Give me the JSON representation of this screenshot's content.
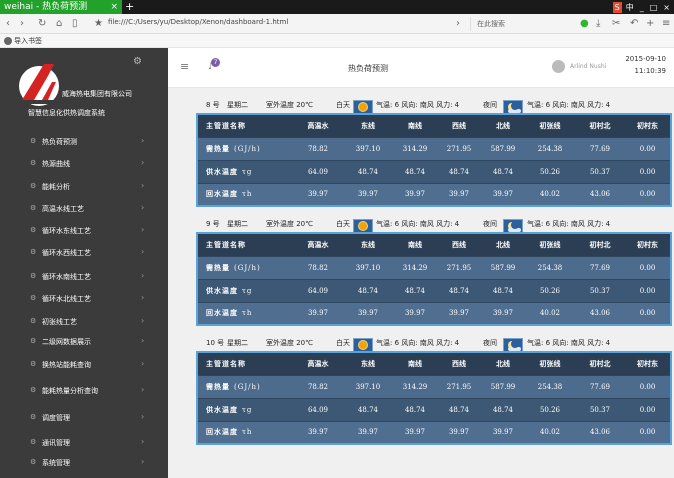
{
  "browser": {
    "tab_title": "weihai - 热负荷预测",
    "tab_close": "×",
    "new_tab": "+",
    "url": "file:///C:/Users/yu/Desktop/Xenon/dashboard-1.html",
    "search_placeholder": "在此搜索",
    "ime_indicator": "中",
    "bookmarks_label": "导入书签"
  },
  "sidebar": {
    "company": "威海热电集团有限公司",
    "system_name": "智慧信息化供热调度系统",
    "items": [
      {
        "label": "热负荷预测"
      },
      {
        "label": "热源曲线"
      },
      {
        "label": "能耗分析"
      },
      {
        "label": "高温水线工艺"
      },
      {
        "label": "循环水东线工艺"
      },
      {
        "label": "循环水西线工艺"
      },
      {
        "label": "循环水南线工艺"
      },
      {
        "label": "循环水北线工艺"
      },
      {
        "label": "初张线工艺"
      },
      {
        "label": "二级网数据展示"
      },
      {
        "label": "换热站能耗查询"
      },
      {
        "label": "能耗热量分析查询"
      },
      {
        "label": "调度管理"
      },
      {
        "label": "通讯管理"
      },
      {
        "label": "系统管理"
      }
    ]
  },
  "header": {
    "title": "热负荷预测",
    "notification_count": "7",
    "user_name": "Arlind Nushi",
    "date": "2015-09-10",
    "time": "11:10:39"
  },
  "table_columns": [
    "主管道名称",
    "高温水",
    "东线",
    "南线",
    "西线",
    "北线",
    "初张线",
    "初村北",
    "初村东"
  ],
  "days": [
    {
      "day": "8 号",
      "weekday": "星期二",
      "outdoor_temp": "室外温度 20℃",
      "daytime_label": "白天",
      "day_weather": "气温: 6 风向: 南风 风力: 4",
      "night_label": "夜间",
      "night_weather": "气温: 6 风向: 南风 风力: 4",
      "rows": [
        {
          "name": "需热量",
          "unit": "(GJ/h)",
          "values": [
            "78.82",
            "397.10",
            "314.29",
            "271.95",
            "587.99",
            "254.38",
            "77.69",
            "0.00"
          ]
        },
        {
          "name": "供水温度",
          "unit": "τg",
          "values": [
            "64.09",
            "48.74",
            "48.74",
            "48.74",
            "48.74",
            "50.26",
            "50.37",
            "0.00"
          ]
        },
        {
          "name": "回水温度",
          "unit": "τh",
          "values": [
            "39.97",
            "39.97",
            "39.97",
            "39.97",
            "39.97",
            "40.02",
            "43.06",
            "0.00"
          ]
        }
      ]
    },
    {
      "day": "9 号",
      "weekday": "星期二",
      "outdoor_temp": "室外温度 20℃",
      "daytime_label": "白天",
      "day_weather": "气温: 6 风向: 南风 风力: 4",
      "night_label": "夜间",
      "night_weather": "气温: 6 风向: 南风 风力: 4",
      "rows": [
        {
          "name": "需热量",
          "unit": "(GJ/h)",
          "values": [
            "78.82",
            "397.10",
            "314.29",
            "271.95",
            "587.99",
            "254.38",
            "77.69",
            "0.00"
          ]
        },
        {
          "name": "供水温度",
          "unit": "τg",
          "values": [
            "64.09",
            "48.74",
            "48.74",
            "48.74",
            "48.74",
            "50.26",
            "50.37",
            "0.00"
          ]
        },
        {
          "name": "回水温度",
          "unit": "τh",
          "values": [
            "39.97",
            "39.97",
            "39.97",
            "39.97",
            "39.97",
            "40.02",
            "43.06",
            "0.00"
          ]
        }
      ]
    },
    {
      "day": "10 号",
      "weekday": "星期二",
      "outdoor_temp": "室外温度 20℃",
      "daytime_label": "白天",
      "day_weather": "气温: 6 风向: 南风 风力: 4",
      "night_label": "夜间",
      "night_weather": "气温: 6 风向: 南风 风力: 4",
      "rows": [
        {
          "name": "需热量",
          "unit": "(GJ/h)",
          "values": [
            "78.82",
            "397.10",
            "314.29",
            "271.95",
            "587.99",
            "254.38",
            "77.69",
            "0.00"
          ]
        },
        {
          "name": "供水温度",
          "unit": "τg",
          "values": [
            "64.09",
            "48.74",
            "48.74",
            "48.74",
            "48.74",
            "50.26",
            "50.37",
            "0.00"
          ]
        },
        {
          "name": "回水温度",
          "unit": "τh",
          "values": [
            "39.97",
            "39.97",
            "39.97",
            "39.97",
            "39.97",
            "40.02",
            "43.06",
            "0.00"
          ]
        }
      ]
    }
  ],
  "icons": {
    "weather_day": "sun-icon",
    "weather_night": "moon-cloud-icon"
  },
  "colors": {
    "tab_green": "#22a22a",
    "sidebar_bg": "#3b3b3b",
    "table_header": "#2b3e53",
    "table_border": "#5aa3d8",
    "badge": "#7b5ea7"
  }
}
